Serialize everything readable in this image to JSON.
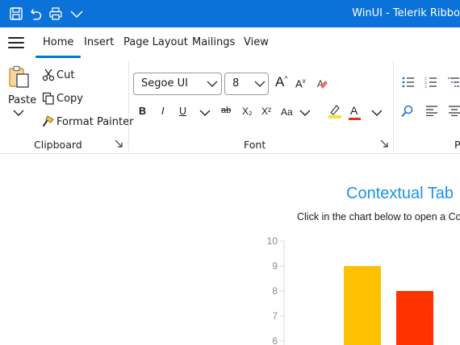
{
  "window": {
    "title": "WinUI - Telerik Ribbo"
  },
  "quick_access": [
    {
      "name": "save-icon"
    },
    {
      "name": "undo-icon"
    },
    {
      "name": "print-icon"
    },
    {
      "name": "customize-chevron-icon"
    }
  ],
  "tabs": [
    {
      "label": "Home",
      "active": true
    },
    {
      "label": "Insert",
      "active": false
    },
    {
      "label": "Page Layout",
      "active": false
    },
    {
      "label": "Mailings",
      "active": false
    },
    {
      "label": "View",
      "active": false
    }
  ],
  "clipboard": {
    "label": "Clipboard",
    "paste": "Paste",
    "cut": "Cut",
    "copy": "Copy",
    "format_painter": "Format Painter"
  },
  "font": {
    "label": "Font",
    "family": "Segoe UI",
    "size": "8",
    "bold": "B",
    "italic": "I",
    "underline": "U",
    "strikethrough": "ab",
    "subscript": "X₂",
    "superscript": "X²",
    "change_case": "Aa",
    "grow": "A",
    "shrink": "A",
    "font_color_glyph": "A"
  },
  "paragraph": {
    "label": "P"
  },
  "content": {
    "heading": "Contextual Tab",
    "subtext": "Click in the chart below to open a Co"
  },
  "colors": {
    "titlebar": "#0a72d8",
    "accent": "#0a72d8",
    "heading": "#1a93e6"
  },
  "chart_data": {
    "type": "bar",
    "y_ticks": [
      "10",
      "9",
      "8",
      "7",
      "6"
    ],
    "ylim": [
      6,
      10
    ],
    "series": [
      {
        "value": 9.0,
        "color": "#ffc000"
      },
      {
        "value": 8.0,
        "color": "#ff3300"
      }
    ]
  }
}
